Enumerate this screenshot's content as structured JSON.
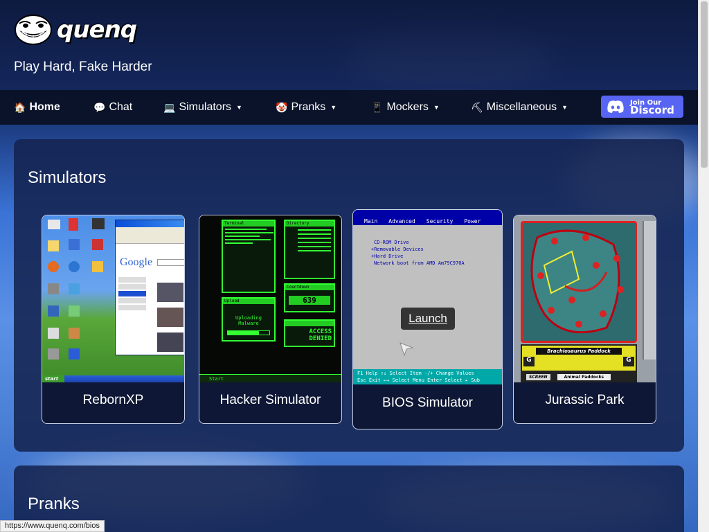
{
  "brand": {
    "name": "quenq",
    "tagline": "Play Hard, Fake Harder"
  },
  "nav": {
    "items": [
      {
        "label": "Home",
        "icon": "house-icon",
        "glyph": "🏠",
        "bold": true
      },
      {
        "label": "Chat",
        "icon": "speech-bubble-icon",
        "glyph": "💬"
      },
      {
        "label": "Simulators",
        "icon": "laptop-icon",
        "glyph": "💻",
        "dropdown": true
      },
      {
        "label": "Pranks",
        "icon": "clown-icon",
        "glyph": "🤡",
        "dropdown": true
      },
      {
        "label": "Mockers",
        "icon": "phone-icon",
        "glyph": "📱",
        "dropdown": true
      },
      {
        "label": "Miscellaneous",
        "icon": "pick-icon",
        "glyph": "⛏",
        "dropdown": true
      }
    ],
    "discord": {
      "line1": "Join Our",
      "line2": "Discord"
    }
  },
  "sections": {
    "simulators": {
      "title": "Simulators",
      "cards": [
        {
          "label": "RebornXP"
        },
        {
          "label": "Hacker Simulator"
        },
        {
          "label": "BIOS Simulator",
          "action": "Launch"
        },
        {
          "label": "Jurassic Park"
        }
      ]
    },
    "pranks": {
      "title": "Pranks"
    }
  },
  "thumbs": {
    "xp": {
      "search_engine": "Google",
      "start": "start"
    },
    "hacker": {
      "title_terminal": "Terminal",
      "title_directory": "Directory",
      "title_upload": "Upload",
      "upload_text_1": "Uploading",
      "upload_text_2": "Malware",
      "countdown_label": "Countdown",
      "countdown": "639",
      "denied_1": "ACCESS",
      "denied_2": "DENIED",
      "start": "Start"
    },
    "bios": {
      "menu": [
        "Main",
        "Advanced",
        "Security",
        "Power"
      ],
      "lines": [
        "CD-ROM Drive",
        "+Removable Devices",
        "+Hard Drive",
        "Network boot from AMD Am79C970A"
      ],
      "footer1": "F1  Help   ↑↓  Select Item   -/+   Change Values",
      "footer2": "Esc  Exit   ←→  Select Menu   Enter  Select ▸ Sub"
    },
    "jurassic": {
      "label": "Brachiosaurus Paddock",
      "screen": "SCREEN",
      "sub": "Animal Paddocks"
    }
  },
  "status": {
    "url": "https://www.quenq.com/bios"
  },
  "colors": {
    "discord": "#5865f2",
    "panel": "#14234f",
    "nav": "#0a1228"
  }
}
